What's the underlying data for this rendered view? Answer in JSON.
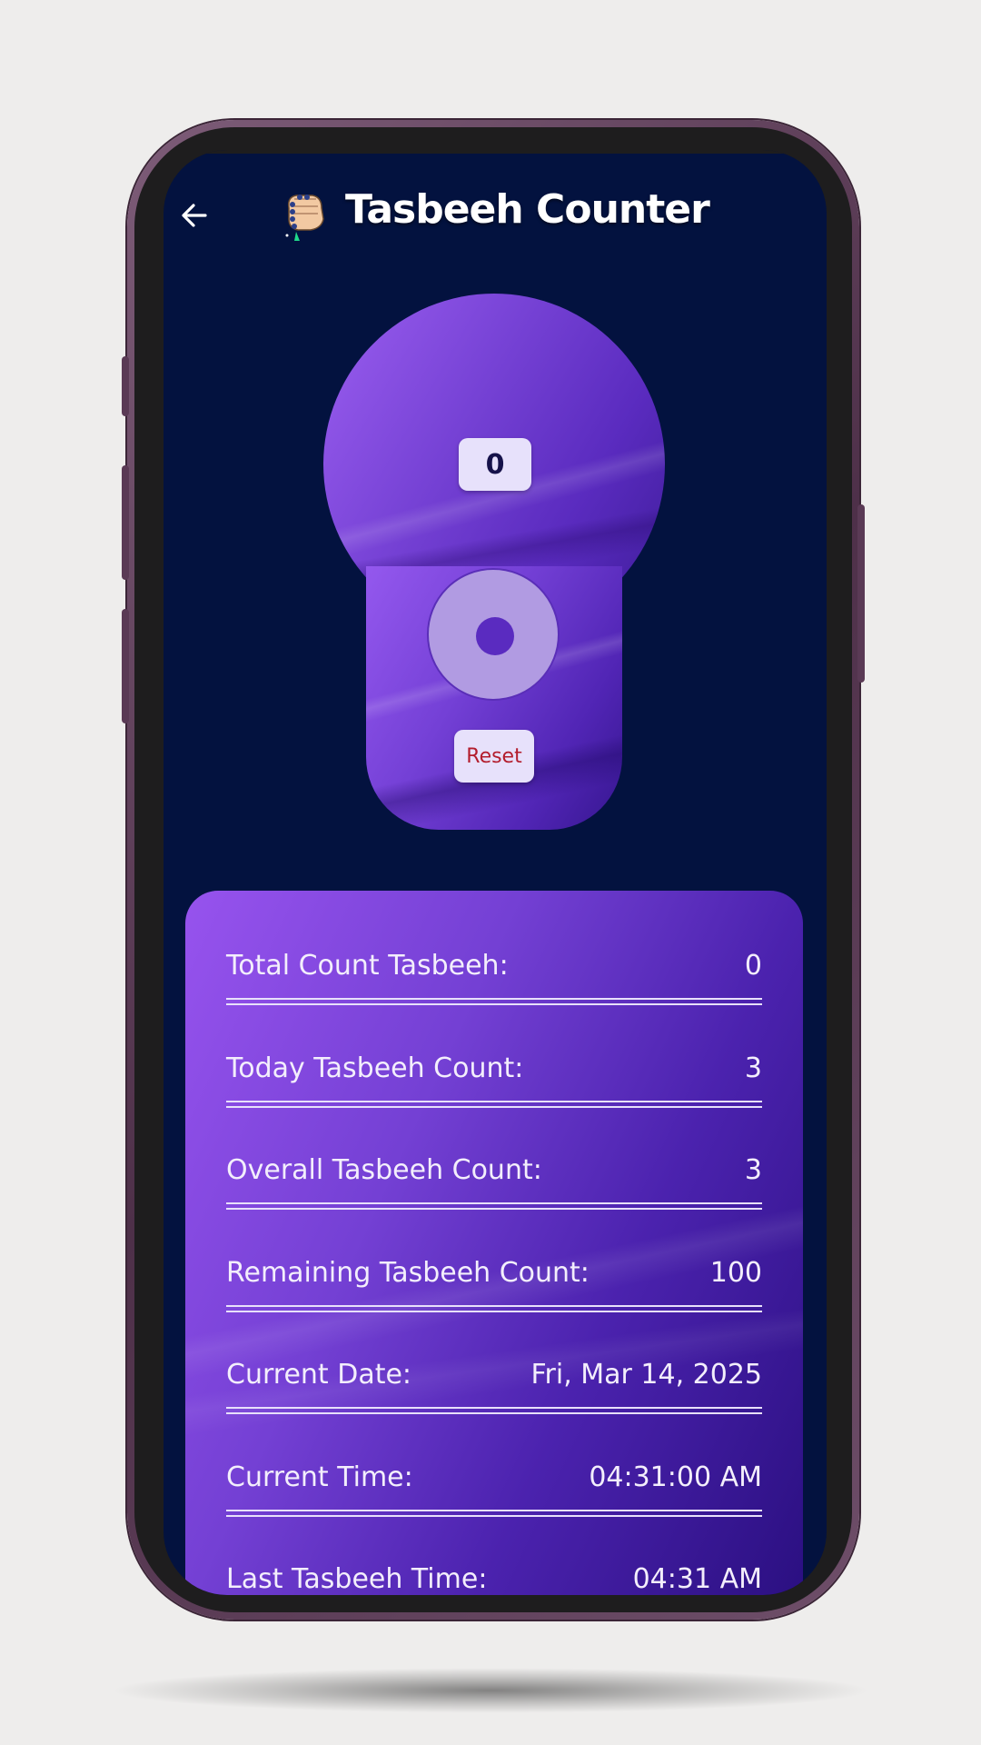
{
  "header": {
    "title": "Tasbeeh Counter"
  },
  "counter": {
    "count": "0",
    "reset_label": "Reset"
  },
  "stats": {
    "rows": [
      {
        "label": "Total Count Tasbeeh:",
        "value": "0"
      },
      {
        "label": "Today Tasbeeh Count:",
        "value": "3"
      },
      {
        "label": "Overall Tasbeeh Count:",
        "value": "3"
      },
      {
        "label": "Remaining Tasbeeh Count:",
        "value": "100"
      },
      {
        "label": "Current Date:",
        "value": "Fri, Mar 14, 2025"
      },
      {
        "label": "Current Time:",
        "value": "04:31:00 AM"
      },
      {
        "label": "Last Tasbeeh Time:",
        "value": "04:31 AM"
      }
    ]
  },
  "colors": {
    "background": "#03123f",
    "accent": "#7a45d8",
    "reset_text": "#b31d2d"
  },
  "icons": {
    "back": "back-arrow-icon",
    "logo": "tasbeeh-hand-icon"
  }
}
